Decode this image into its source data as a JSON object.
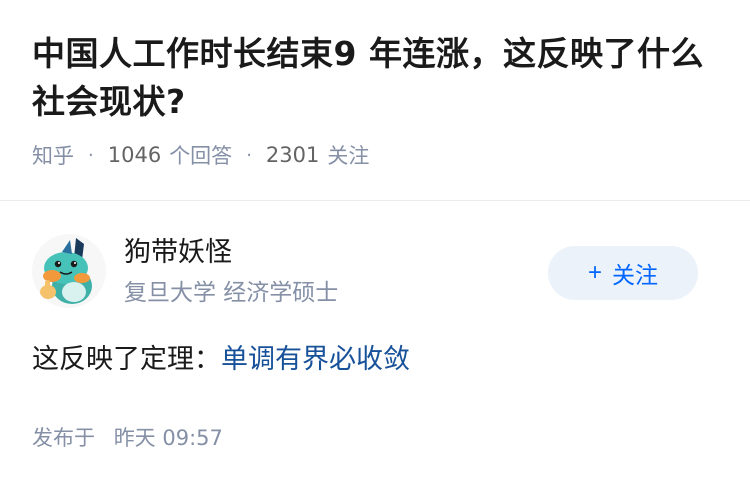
{
  "question": {
    "title": "中国人工作时长结束9 年连涨，这反映了什么社会现状?",
    "source": "知乎",
    "answers_count": "1046",
    "answers_label": "个回答",
    "followers_count": "2301",
    "followers_label": "关注"
  },
  "answer": {
    "author": {
      "name": "狗带妖怪",
      "bio": "复旦大学 经济学硕士",
      "avatar_icon": "mudkip-avatar",
      "follow_label": "关注",
      "follow_icon": "plus-icon"
    },
    "content_prefix": "这反映了定理：",
    "content_link": "单调有界必收敛",
    "publish_label": "发布于",
    "publish_time": "昨天 09:57"
  },
  "colors": {
    "link": "#175199",
    "follow_text": "#0066ff",
    "follow_bg": "#ebf2fa",
    "meta": "#8590a6"
  }
}
